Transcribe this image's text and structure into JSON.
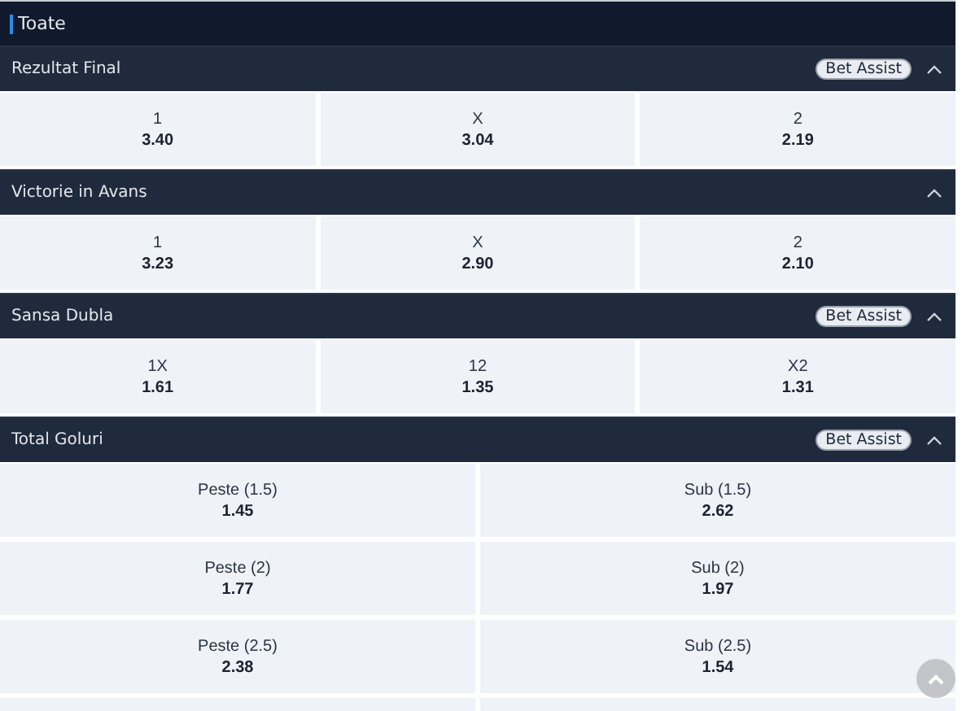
{
  "filter": {
    "label": "Toate"
  },
  "markets": [
    {
      "title": "Rezultat Final",
      "bet_assist": "Bet Assist",
      "expanded": true,
      "outcomes": [
        {
          "label": "1",
          "odds": "3.40"
        },
        {
          "label": "X",
          "odds": "3.04"
        },
        {
          "label": "2",
          "odds": "2.19"
        }
      ]
    },
    {
      "title": "Victorie in Avans",
      "expanded": true,
      "outcomes": [
        {
          "label": "1",
          "odds": "3.23"
        },
        {
          "label": "X",
          "odds": "2.90"
        },
        {
          "label": "2",
          "odds": "2.10"
        }
      ]
    },
    {
      "title": "Sansa Dubla",
      "bet_assist": "Bet Assist",
      "expanded": true,
      "outcomes": [
        {
          "label": "1X",
          "odds": "1.61"
        },
        {
          "label": "12",
          "odds": "1.35"
        },
        {
          "label": "X2",
          "odds": "1.31"
        }
      ]
    },
    {
      "title": "Total Goluri",
      "bet_assist": "Bet Assist",
      "expanded": true,
      "more_rows_cut": true,
      "outcomes": [
        {
          "label": "Peste (1.5)",
          "odds": "1.45"
        },
        {
          "label": "Sub (1.5)",
          "odds": "2.62"
        },
        {
          "label": "Peste (2)",
          "odds": "1.77"
        },
        {
          "label": "Sub (2)",
          "odds": "1.97"
        },
        {
          "label": "Peste (2.5)",
          "odds": "2.38"
        },
        {
          "label": "Sub (2.5)",
          "odds": "1.54"
        }
      ]
    }
  ]
}
